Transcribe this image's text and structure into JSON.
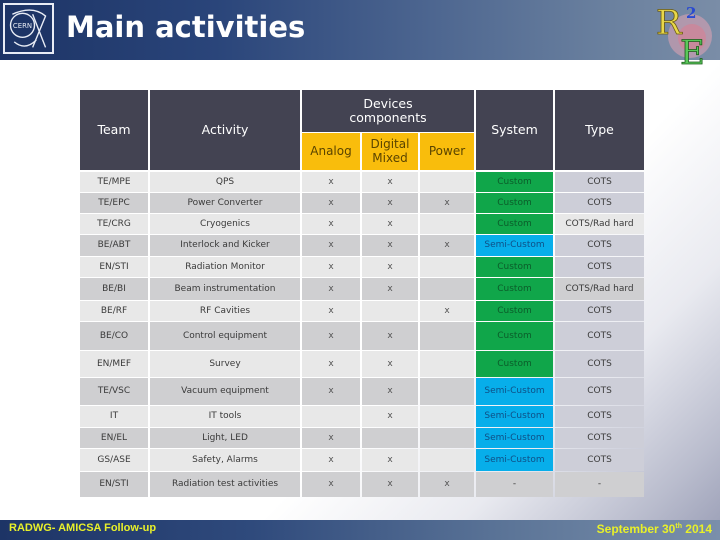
{
  "header": {
    "title": "Main activities",
    "logo_left": "CERN",
    "logo_right": "R2E"
  },
  "table": {
    "columns": {
      "team": "Team",
      "activity": "Activity",
      "devices_group": "Devices components",
      "analog": "Analog",
      "digital_mixed": "Digital Mixed",
      "power": "Power",
      "system": "System",
      "type": "Type"
    },
    "rows": [
      {
        "team": "TE/MPE",
        "activity": "QPS",
        "analog": "x",
        "digital": "x",
        "power": "",
        "system": "Custom",
        "type": "COTS"
      },
      {
        "team": "TE/EPC",
        "activity": "Power Converter",
        "analog": "x",
        "digital": "x",
        "power": "x",
        "system": "Custom",
        "type": "COTS"
      },
      {
        "team": "TE/CRG",
        "activity": "Cryogenics",
        "analog": "x",
        "digital": "x",
        "power": "",
        "system": "Custom",
        "type": "COTS/Rad hard"
      },
      {
        "team": "BE/ABT",
        "activity": "Interlock and Kicker",
        "analog": "x",
        "digital": "x",
        "power": "x",
        "system": "Semi-Custom",
        "type": "COTS"
      },
      {
        "team": "EN/STI",
        "activity": "Radiation Monitor",
        "analog": "x",
        "digital": "x",
        "power": "",
        "system": "Custom",
        "type": "COTS"
      },
      {
        "team": "BE/BI",
        "activity": "Beam instrumentation",
        "analog": "x",
        "digital": "x",
        "power": "",
        "system": "Custom",
        "type": "COTS/Rad hard"
      },
      {
        "team": "BE/RF",
        "activity": "RF Cavities",
        "analog": "x",
        "digital": "",
        "power": "x",
        "system": "Custom",
        "type": "COTS"
      },
      {
        "team": "BE/CO",
        "activity": "Control equipment",
        "analog": "x",
        "digital": "x",
        "power": "",
        "system": "Custom",
        "type": "COTS"
      },
      {
        "team": "EN/MEF",
        "activity": "Survey",
        "analog": "x",
        "digital": "x",
        "power": "",
        "system": "Custom",
        "type": "COTS"
      },
      {
        "team": "TE/VSC",
        "activity": "Vacuum equipment",
        "analog": "x",
        "digital": "x",
        "power": "",
        "system": "Semi-Custom",
        "type": "COTS"
      },
      {
        "team": "IT",
        "activity": "IT tools",
        "analog": "",
        "digital": "x",
        "power": "",
        "system": "Semi-Custom",
        "type": "COTS"
      },
      {
        "team": "EN/EL",
        "activity": "Light, LED",
        "analog": "x",
        "digital": "",
        "power": "",
        "system": "Semi-Custom",
        "type": "COTS"
      },
      {
        "team": "GS/ASE",
        "activity": "Safety, Alarms",
        "analog": "x",
        "digital": "x",
        "power": "",
        "system": "Semi-Custom",
        "type": "COTS"
      },
      {
        "team": "EN/STI",
        "activity": "Radiation test activities",
        "analog": "x",
        "digital": "x",
        "power": "x",
        "system": "-",
        "type": "-"
      }
    ]
  },
  "colors": {
    "header_bg": "#434352",
    "subheader_bg": "#f9bd0c",
    "custom": "#10a64a",
    "semi_custom": "#07aeea",
    "cots": "#cdced8",
    "row_light": "#e8e8e8",
    "row_dark": "#cfcfd1",
    "footer_text": "#e8f02a"
  },
  "footer": {
    "left": "RADWG- AMICSA Follow-up",
    "date_prefix": "September 30",
    "date_sup": "th",
    "date_suffix": " 2014"
  }
}
